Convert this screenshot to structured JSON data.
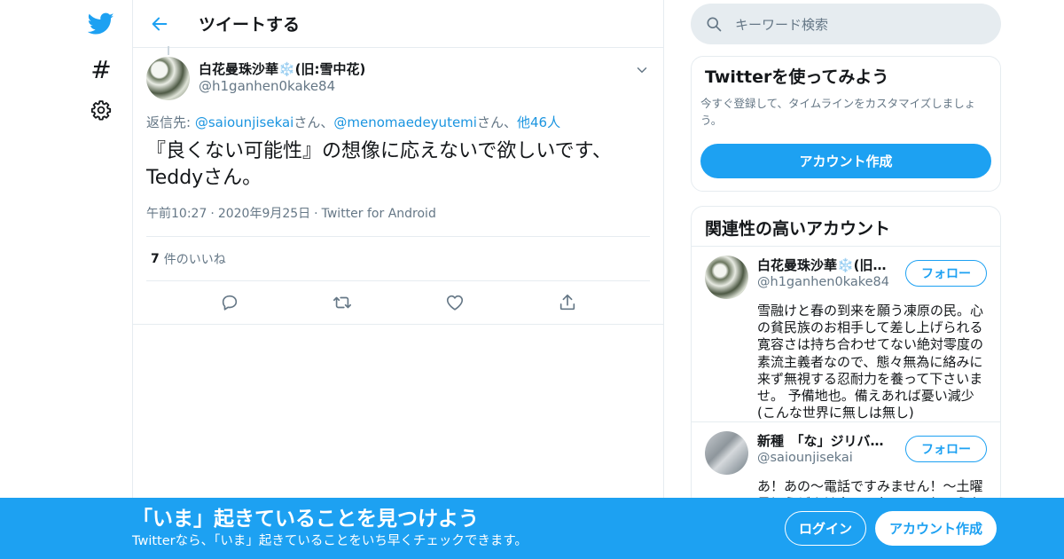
{
  "colors": {
    "accent": "#1da1f2",
    "link": "#1b95e0",
    "muted": "#657786",
    "border": "#e6ecf0"
  },
  "nav": {
    "items": [
      {
        "icon": "twitter-bird-icon"
      },
      {
        "icon": "hashtag-icon",
        "glyph": "#"
      },
      {
        "icon": "gear-icon"
      }
    ]
  },
  "header": {
    "back_icon": "arrow-left-icon",
    "title": "ツイートする"
  },
  "tweet": {
    "display_name": "白花曼珠沙華❄️(旧:雪中花)",
    "handle": "@h1ganhen0kake84",
    "reply_prefix": "返信先: ",
    "reply_user1": "@saiounjisekai",
    "reply_sep1": "さん、",
    "reply_user2": "@menomaedeyutemi",
    "reply_sep2": "さん、",
    "reply_others": "他46人",
    "text_line1": "『良くない可能性』の想像に応えないで欲しいです、",
    "text_line2": "Teddyさん。",
    "time": "午前10:27",
    "date": "2020年9月25日",
    "source": "Twitter for Android",
    "dot": "·",
    "likes_count": "7",
    "likes_label": "件のいいね"
  },
  "search": {
    "placeholder": "キーワード検索"
  },
  "try_card": {
    "title": "Twitterを使ってみよう",
    "description": "今すぐ登録して、タイムラインをカスタマイズしましょう。",
    "button": "アカウント作成"
  },
  "related": {
    "title": "関連性の高いアカウント",
    "users": [
      {
        "name": "白花曼珠沙華❄️(旧:…",
        "handle": "@h1ganhen0kake84",
        "follow": "フォロー",
        "bio": "雪融けと春の到来を願う凍原の民。心の貧民族のお相手して差し上げられる寛容さは持ち合わせてない絶対零度の素流主義者なので、態々無為に絡みに来ず無視する忍耐力を養って下さいませ。 予備地也。備えあれば憂い減少(こんな世界に無しは無し)"
      },
      {
        "name": "新種　「な」ジリバ…",
        "handle": "@saiounjisekai",
        "follow": "フォロー",
        "bio": "あ！あの～電話ですみません！～土曜日にうどんはやってないのでしょうか"
      }
    ]
  },
  "banner": {
    "title": "「いま」起きていることを見つけよう",
    "subtitle": "Twitterなら、「いま」起きていることをいち早くチェックできます。",
    "login": "ログイン",
    "signup": "アカウント作成"
  }
}
